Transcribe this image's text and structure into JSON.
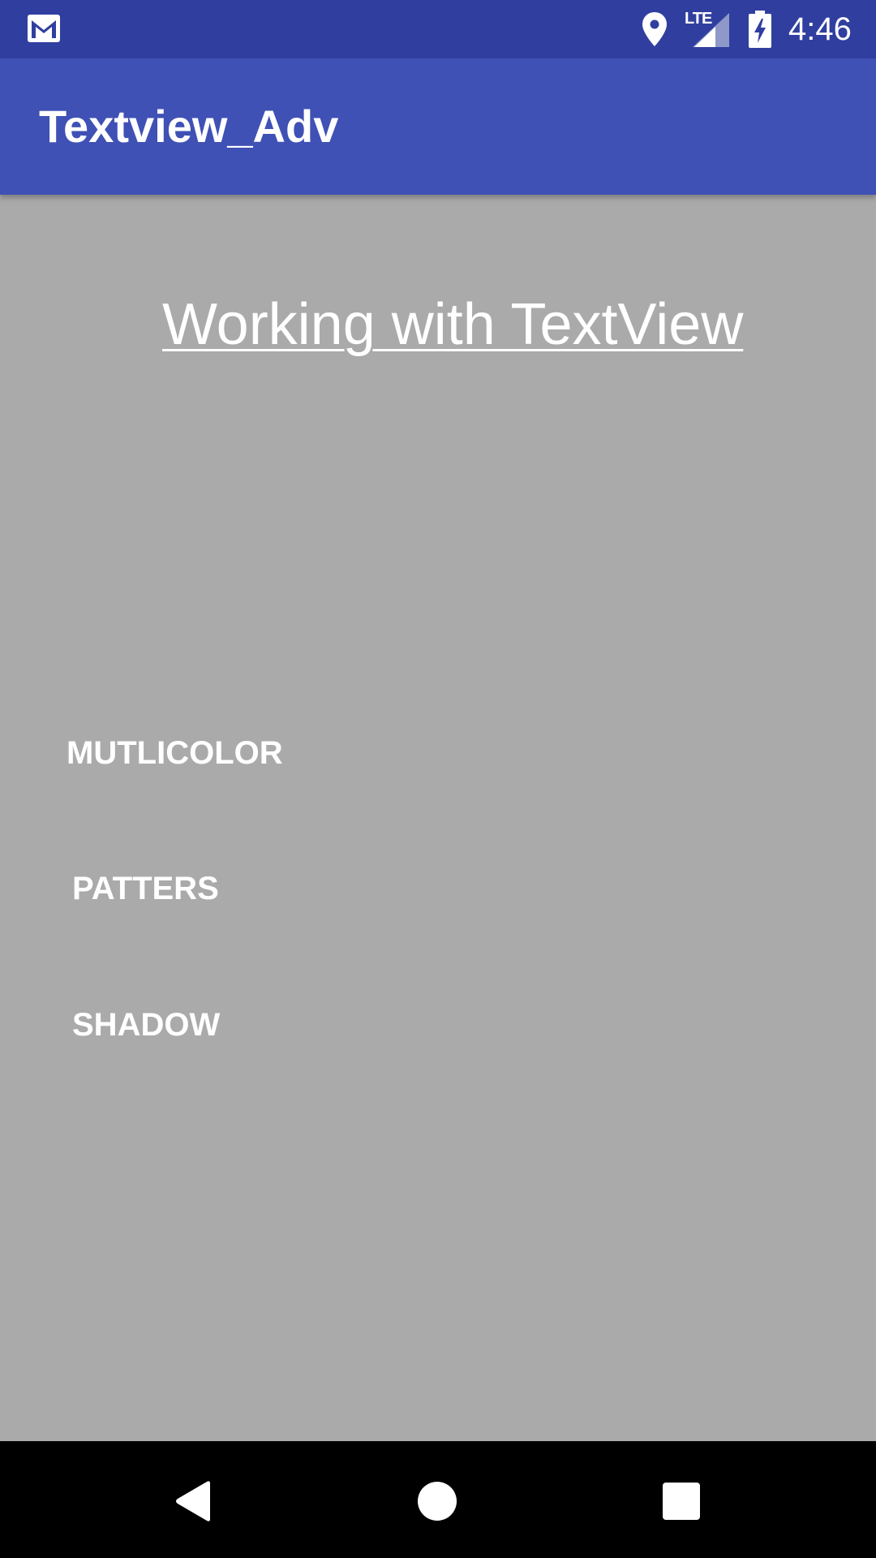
{
  "status_bar": {
    "time": "4:46",
    "network_label": "LTE",
    "color": "#303f9f",
    "icons": [
      "gmail-icon",
      "location-icon",
      "signal-icon",
      "battery-charging-icon"
    ]
  },
  "app_bar": {
    "title": "Textview_Adv",
    "color": "#3f51b5"
  },
  "main": {
    "background": "#aaaaaa",
    "heading": "Working with TextView",
    "buttons": [
      {
        "label": "MUTLICOLOR"
      },
      {
        "label": "PATTERS"
      },
      {
        "label": "SHADOW"
      }
    ]
  },
  "nav_bar": {
    "icons": [
      "back-icon",
      "home-icon",
      "recents-icon"
    ]
  }
}
